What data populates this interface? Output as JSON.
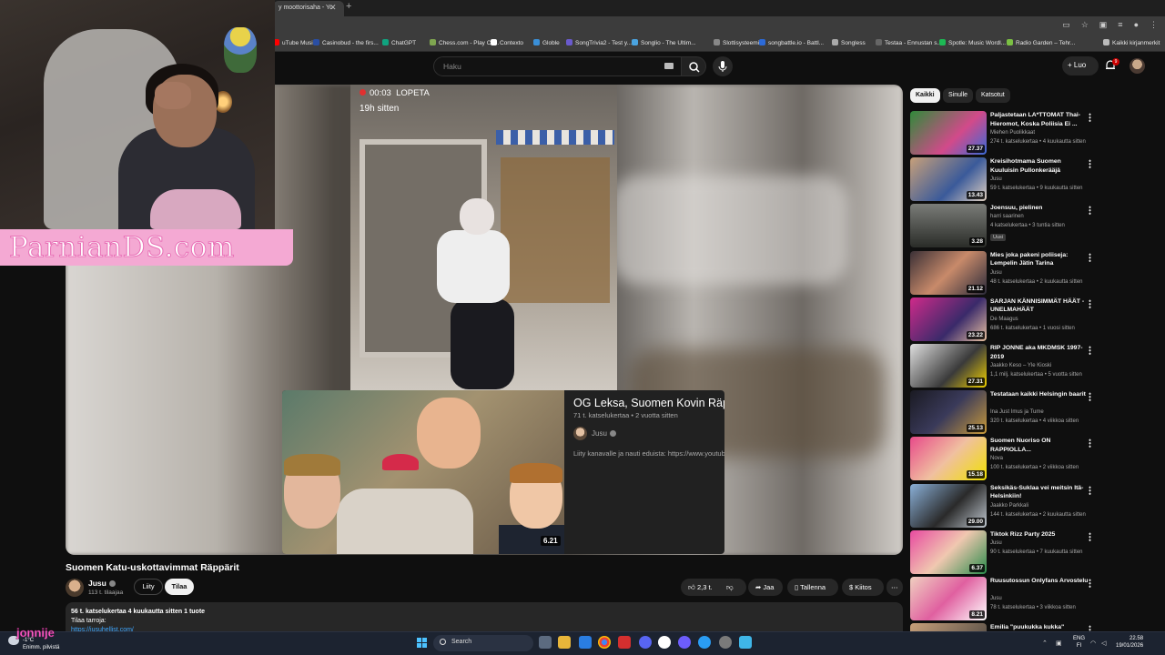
{
  "browser": {
    "tab_title": "y moottorisaha - Yo",
    "bookmarks": [
      {
        "label": "uTube Music",
        "color": "#ff0000"
      },
      {
        "label": "Casinobud - the firs...",
        "color": "#2a4ea3"
      },
      {
        "label": "ChatGPT",
        "color": "#10a37f"
      },
      {
        "label": "Chess.com - Play Ch...",
        "color": "#7fa650"
      },
      {
        "label": "Contexto",
        "color": "#ffffff"
      },
      {
        "label": "Globle",
        "color": "#3a8fd8"
      },
      {
        "label": "SongTrivia2 - Test y...",
        "color": "#6a5acd"
      },
      {
        "label": "Songlio - The Ultim...",
        "color": "#4aa3df"
      },
      {
        "label": "Slottisysteemit",
        "color": "#888888"
      },
      {
        "label": "songbattle.io - Battl...",
        "color": "#2c6ad8"
      },
      {
        "label": "Songless",
        "color": "#aaaaaa"
      },
      {
        "label": "Testaa - Ennustan s...",
        "color": "#666666"
      },
      {
        "label": "Spotle: Music Wordl...",
        "color": "#1db954"
      },
      {
        "label": "Radio Garden – Tehr...",
        "color": "#7bc043"
      },
      {
        "label": "Kaikki kirjanmerkit",
        "color": "#bbbbbb"
      }
    ]
  },
  "header": {
    "search_placeholder": "Haku",
    "create_label": "Luo",
    "notification_count": "9"
  },
  "overlay": {
    "brand": "ParnianDS.com",
    "streamer_tag": "jonnije"
  },
  "player": {
    "rec_label": "00:03",
    "rec_stop": "LOPETA",
    "rec_time_ago": "19h sitten"
  },
  "preview": {
    "title": "OG Leksa, Suomen Kovin Räppäri",
    "meta": "71 t. katselukertaa • 2 vuotta sitten",
    "channel": "Jusu",
    "description": "Liity kanavalle ja nauti eduista: https://www.youtub",
    "duration": "6.21"
  },
  "video": {
    "title": "Suomen Katu-uskottavimmat Räppärit",
    "channel": "Jusu",
    "subscribers": "113 t. tilaajaa",
    "join_label": "Liity",
    "subscribe_label": "Tilaa",
    "likes": "2,3 t.",
    "share_label": "Jaa",
    "save_label": "Tallenna",
    "thanks_label": "Kiitos",
    "desc_stats": "56 t. katselukertaa  4 kuukautta sitten  1 tuote",
    "desc_line": "Tilaa tarroja:",
    "desc_link": "https://jusuhellist.com/"
  },
  "sidebar": {
    "chips": [
      "Kaikki",
      "Sinulle",
      "Katsotut"
    ],
    "items": [
      {
        "title": "Paljastetaan LA*TTOMAT Thai-Hieromot, Koska Poliisia Ei ...",
        "channel": "Miehen Puolikkaat",
        "meta": "274 t. katselukertaa • 4 kuukautta sitten",
        "duration": "27.37"
      },
      {
        "title": "Kreisihotmama Suomen Kuuluisin Pullonkerääjä",
        "channel": "Jusu",
        "meta": "59 t. katselukertaa • 9 kuukautta sitten",
        "duration": "13.43"
      },
      {
        "title": "Joensuu, pielinen",
        "channel": "harri saarinen",
        "meta": "4 katselukertaa • 3 tuntia sitten",
        "badge": "Uusi",
        "duration": "3.28"
      },
      {
        "title": "Mies joka pakeni poliiseja: Lempelin Jätin Tarina",
        "channel": "Jusu",
        "meta": "48 t. katselukertaa • 2 kuukautta sitten",
        "duration": "21.12"
      },
      {
        "title": "SARJAN KÄNNISIMMÄT HÄÄT - UNELMAHÄÄT",
        "channel": "De Maagus",
        "meta": "686 t. katselukertaa • 1 vuosi sitten",
        "duration": "23.22"
      },
      {
        "title": "RIP JONNE aka MKDMSK 1997-2019",
        "channel": "Jaakko Keso – Yle Kioski",
        "meta": "1,1 milj. katselukertaa • 5 vuotta sitten",
        "duration": "27.31"
      },
      {
        "title": "Testataan kaikki Helsingin baarit",
        "channel": "Ina Just Imus ja Tume",
        "meta": "320 t. katselukertaa • 4 viikkoa sitten",
        "duration": "25.13"
      },
      {
        "title": "Suomen Nuoriso ON RAPPIOLLA...",
        "channel": "Nova",
        "meta": "100 t. katselukertaa • 2 viikkoa sitten",
        "duration": "15.18"
      },
      {
        "title": "Seksikäs-Suklaa vei meitsin Itä-Helsinkiin!",
        "channel": "Jaakko Parkkali",
        "meta": "144 t. katselukertaa • 2 kuukautta sitten",
        "duration": "29.00"
      },
      {
        "title": "Tiktok Rizz Party 2025",
        "channel": "Jusu",
        "meta": "90 t. katselukertaa • 7 kuukautta sitten",
        "duration": "6.37"
      },
      {
        "title": "Ruusutossun Onlyfans Arvostelu",
        "channel": "Jusu",
        "meta": "78 t. katselukertaa • 3 viikkoa sitten",
        "duration": "8.21"
      },
      {
        "title": "Emilia \"puukukka kukka\"",
        "channel": "",
        "meta": "",
        "duration": ""
      }
    ]
  },
  "taskbar": {
    "weather_line1": "-1°C",
    "weather_line2": "Enimm. pilvistä",
    "search_label": "Search",
    "lang_line1": "ENG",
    "lang_line2": "FI",
    "time": "22.58",
    "date": "19/01/2026"
  }
}
